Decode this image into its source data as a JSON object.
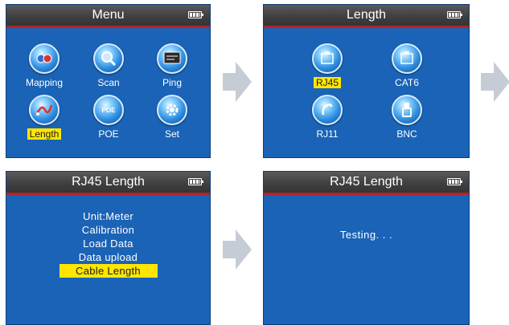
{
  "screens": [
    {
      "title": "Menu",
      "items": [
        {
          "label": "Mapping",
          "icon": "mapping-icon",
          "selected": false
        },
        {
          "label": "Scan",
          "icon": "scan-icon",
          "selected": false
        },
        {
          "label": "Ping",
          "icon": "ping-icon",
          "selected": false
        },
        {
          "label": "Length",
          "icon": "length-icon",
          "selected": true
        },
        {
          "label": "POE",
          "icon": "poe-icon",
          "selected": false
        },
        {
          "label": "Set",
          "icon": "set-icon",
          "selected": false
        }
      ]
    },
    {
      "title": "Length",
      "items": [
        {
          "label": "RJ45",
          "icon": "rj45-icon",
          "selected": true
        },
        {
          "label": "CAT6",
          "icon": "cat6-icon",
          "selected": false
        },
        {
          "label": "RJ11",
          "icon": "rj11-icon",
          "selected": false
        },
        {
          "label": "BNC",
          "icon": "bnc-icon",
          "selected": false
        }
      ]
    },
    {
      "title": "RJ45 Length",
      "items": [
        {
          "label": "Unit:Meter",
          "selected": false
        },
        {
          "label": "Calibration",
          "selected": false
        },
        {
          "label": "Load Data",
          "selected": false
        },
        {
          "label": "Data upload",
          "selected": false
        },
        {
          "label": "Cable Length",
          "selected": true
        }
      ]
    },
    {
      "title": "RJ45 Length",
      "status": "Testing. . ."
    }
  ],
  "colors": {
    "screen_bg": "#1a63b6",
    "titlebar_bg": "#3e3e3e",
    "titlebar_accent": "#b3242b",
    "highlight": "#ffe600",
    "arrow": "#c5ccd6"
  },
  "arrow_icon": "chevron-right-arrow-icon"
}
